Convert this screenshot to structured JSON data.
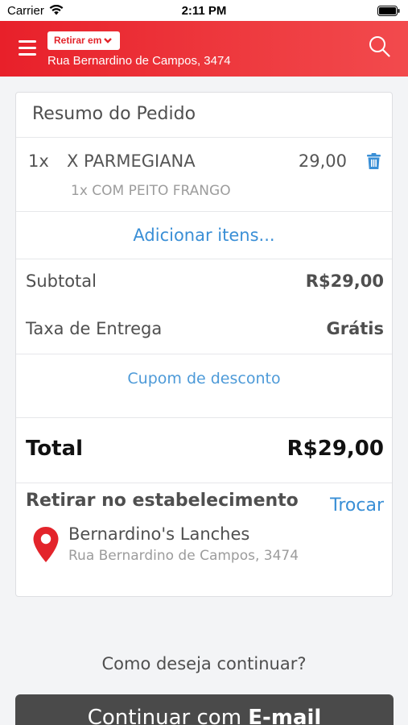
{
  "status_bar": {
    "carrier": "Carrier",
    "time": "2:11 PM"
  },
  "header": {
    "pickup_mode": "Retirar em",
    "address": "Rua Bernardino de Campos, 3474",
    "accent_color": "#e8202a"
  },
  "order": {
    "title": "Resumo do Pedido",
    "items": [
      {
        "qty": "1x",
        "name": "X PARMEGIANA",
        "price": "29,00",
        "detail": "1x COM PEITO FRANGO"
      }
    ],
    "add_items_label": "Adicionar itens...",
    "subtotal_label": "Subtotal",
    "subtotal_value": "R$29,00",
    "delivery_fee_label": "Taxa de Entrega",
    "delivery_fee_value": "Grátis",
    "coupon_label": "Cupom de desconto",
    "total_label": "Total",
    "total_value": "R$29,00"
  },
  "pickup": {
    "title": "Retirar no estabelecimento",
    "change_label": "Trocar",
    "store_name": "Bernardino's Lanches",
    "store_address": "Rua Bernardino de Campos, 3474"
  },
  "footer": {
    "question": "Como deseja continuar?",
    "continue_prefix": "Continuar com ",
    "continue_method": "E-mail"
  },
  "icons": [
    "menu-icon",
    "chevron-down-icon",
    "search-icon",
    "trash-icon",
    "map-pin-icon",
    "wifi-icon",
    "battery-icon"
  ]
}
